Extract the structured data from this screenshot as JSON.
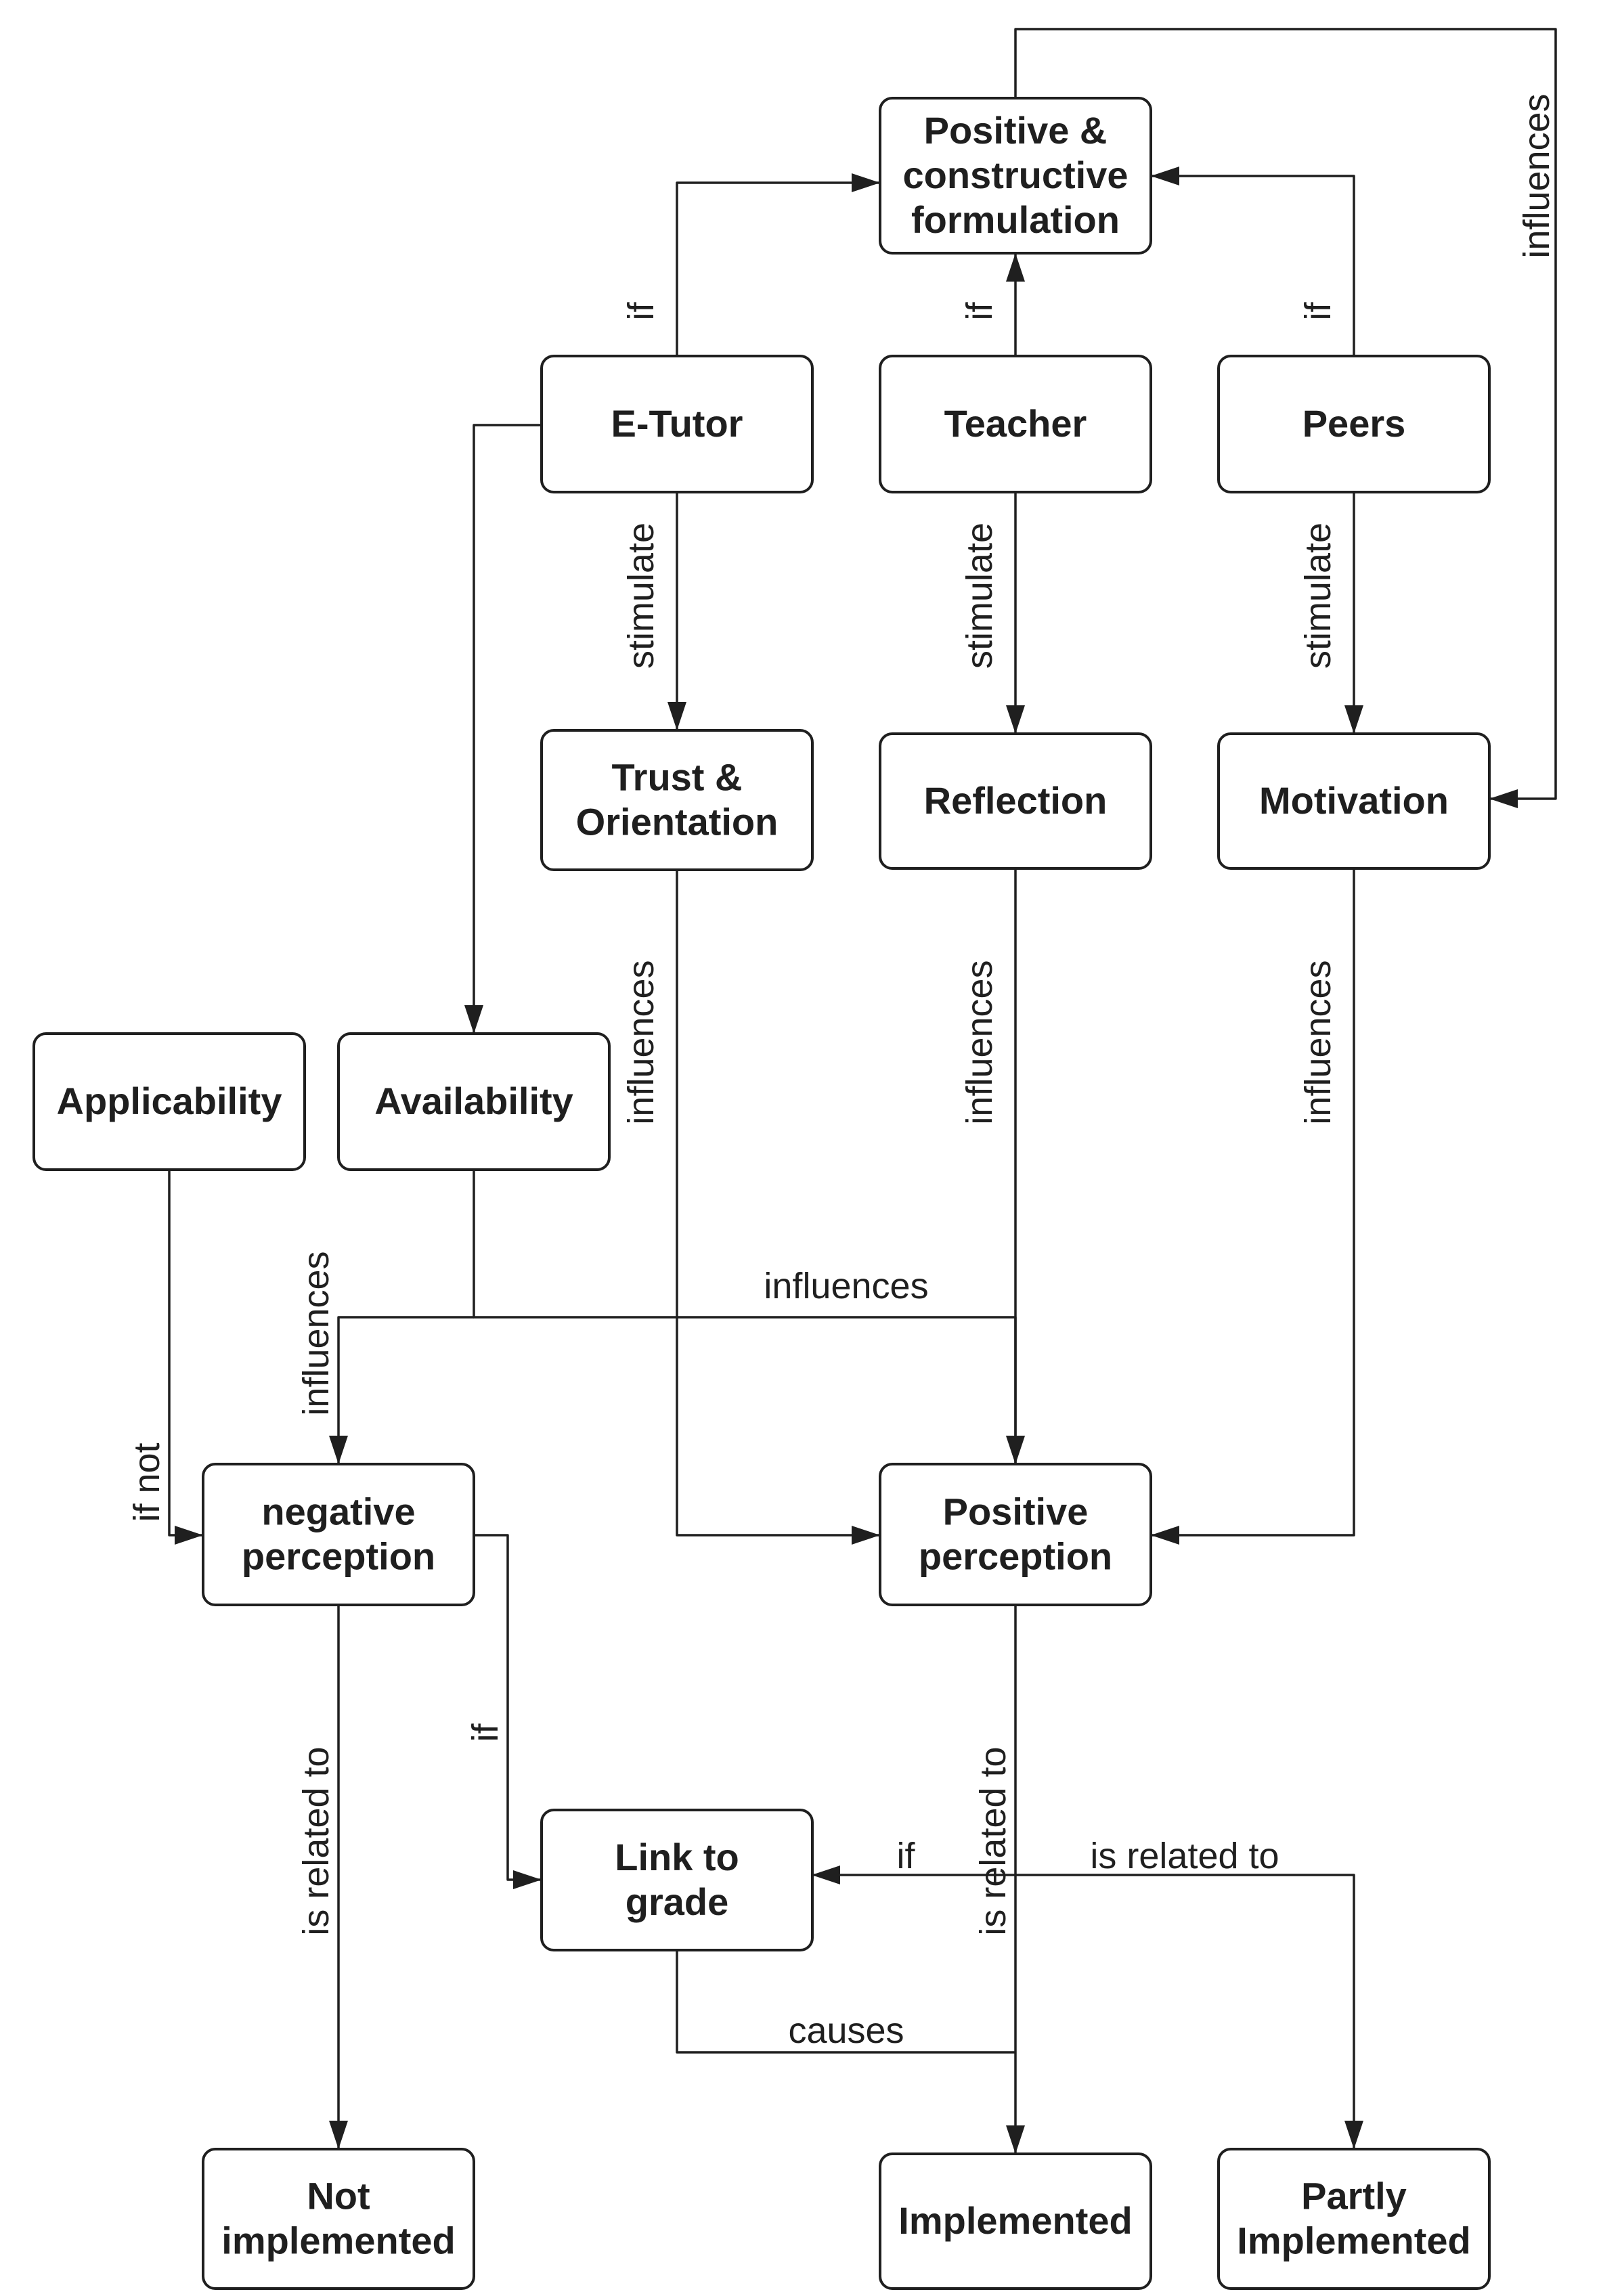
{
  "diagram": {
    "nodes": [
      {
        "id": "pcf",
        "lines": [
          "Positive &",
          "constructive",
          "formulation"
        ]
      },
      {
        "id": "etutor",
        "lines": [
          "E-Tutor"
        ]
      },
      {
        "id": "teacher",
        "lines": [
          "Teacher"
        ]
      },
      {
        "id": "peers",
        "lines": [
          "Peers"
        ]
      },
      {
        "id": "trust",
        "lines": [
          "Trust &",
          "Orientation"
        ]
      },
      {
        "id": "reflection",
        "lines": [
          "Reflection"
        ]
      },
      {
        "id": "motivation",
        "lines": [
          "Motivation"
        ]
      },
      {
        "id": "applicability",
        "lines": [
          "Applicability"
        ]
      },
      {
        "id": "availability",
        "lines": [
          "Availability"
        ]
      },
      {
        "id": "negative",
        "lines": [
          "negative",
          "perception"
        ]
      },
      {
        "id": "positive",
        "lines": [
          "Positive",
          "perception"
        ]
      },
      {
        "id": "link",
        "lines": [
          "Link to",
          "grade"
        ]
      },
      {
        "id": "notimpl",
        "lines": [
          "Not",
          "implemented"
        ]
      },
      {
        "id": "impl",
        "lines": [
          "Implemented"
        ]
      },
      {
        "id": "partly",
        "lines": [
          "Partly",
          "Implemented"
        ]
      }
    ],
    "edges": [
      {
        "id": "etutor-pcf",
        "from": "etutor",
        "to": "pcf",
        "label": "if"
      },
      {
        "id": "teacher-pcf",
        "from": "teacher",
        "to": "pcf",
        "label": "if"
      },
      {
        "id": "peers-pcf",
        "from": "peers",
        "to": "pcf",
        "label": "if"
      },
      {
        "id": "pcf-motivation",
        "from": "pcf",
        "to": "motivation",
        "label": "influences"
      },
      {
        "id": "etutor-trust",
        "from": "etutor",
        "to": "trust",
        "label": "stimulate"
      },
      {
        "id": "teacher-reflection",
        "from": "teacher",
        "to": "reflection",
        "label": "stimulate"
      },
      {
        "id": "peers-motivation",
        "from": "peers",
        "to": "motivation",
        "label": "stimulate"
      },
      {
        "id": "etutor-availability",
        "from": "etutor",
        "to": "availability",
        "label": ""
      },
      {
        "id": "trust-positive",
        "from": "trust",
        "to": "positive",
        "label": "influences"
      },
      {
        "id": "reflection-positive",
        "from": "reflection",
        "to": "positive",
        "label": "influences"
      },
      {
        "id": "motivation-positive",
        "from": "motivation",
        "to": "positive",
        "label": "influences"
      },
      {
        "id": "availability-positive",
        "from": "availability",
        "to": "positive",
        "label": "influences"
      },
      {
        "id": "availability-negative",
        "from": "availability",
        "to": "negative",
        "label": "influences"
      },
      {
        "id": "applicability-negative",
        "from": "applicability",
        "to": "negative",
        "label": "if not"
      },
      {
        "id": "negative-link",
        "from": "negative",
        "to": "link",
        "label": "if"
      },
      {
        "id": "negative-notimpl",
        "from": "negative",
        "to": "notimpl",
        "label": "is related to"
      },
      {
        "id": "positive-impl",
        "from": "positive",
        "to": "impl",
        "label": "is related to"
      },
      {
        "id": "positive-link",
        "from": "positive",
        "to": "link",
        "label": "if"
      },
      {
        "id": "positive-partly",
        "from": "positive",
        "to": "partly",
        "label": "is related to"
      },
      {
        "id": "link-impl",
        "from": "link",
        "to": "impl",
        "label": "causes"
      }
    ]
  }
}
